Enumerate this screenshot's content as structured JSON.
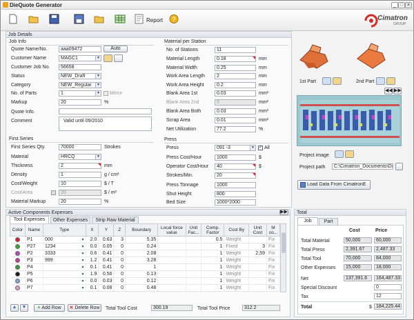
{
  "app": {
    "title": "DieQuote Generator",
    "report_label": "Report",
    "brand": "Cimatron",
    "brand_sub": "GROUP"
  },
  "job_details": {
    "section_title": "Job Details",
    "job_info_title": "Job Info",
    "quote_name_label": "Quote Name/No.",
    "quote_name": "aaa09472",
    "auto_label": "Auto",
    "customer_name_label": "Customer Name",
    "customer_name": "MAGC1",
    "customer_job_label": "Customer Job No.",
    "customer_job": "56658",
    "status_label": "Status",
    "status": "NEW_Draft",
    "category_label": "Category",
    "category": "NEW_Regular",
    "parts_label": "No. of Parts",
    "parts": "1",
    "mirror_label": "Mirror",
    "markup_label": "Markup",
    "markup": "20",
    "markup_unit": "%",
    "quote_info_label": "Quote Info.",
    "quote_info": "",
    "comment_label": "Comment",
    "comment": "Valid until 09/2010"
  },
  "first_series": {
    "title": "First Series",
    "qty_label": "First Series Qty.",
    "qty": "70000",
    "qty_unit": "Strokes",
    "material_label": "Material",
    "material": "HRCQ",
    "thickness_label": "Thickness",
    "thickness": "2",
    "thickness_unit": "mm",
    "density_label": "Density",
    "density": "1",
    "density_unit": "g / cm³",
    "cost_weight_label": "Cost/Weight",
    "cost_weight": "10",
    "cost_weight_unit": "$ / T",
    "cost_area_label": "Cost/Area",
    "cost_area": "20",
    "cost_area_unit": "$ / m²",
    "mat_markup_label": "Material Markup",
    "mat_markup": "20",
    "mat_markup_unit": "%"
  },
  "material_per_station": {
    "title": "Material per Station",
    "stations_label": "No. of Stations",
    "stations": "11",
    "length_label": "Material Length",
    "length": "0.18",
    "length_unit": "mm",
    "width_label": "Material Width",
    "width": "0.25",
    "width_unit": "mm",
    "wal_label": "Work Area Length",
    "wal": "2",
    "wal_unit": "mm",
    "wah_label": "Work Area Height",
    "wah": "0.2",
    "wah_unit": "mm",
    "ba1_label": "Blank Area 1st",
    "ba1": "0.03",
    "ba1_unit": "mm²",
    "ba2_label": "Blank Area 2nd",
    "ba2": "0",
    "ba2_unit": "mm²",
    "bab_label": "Blank Area Both",
    "bab": "0.03",
    "bab_unit": "mm²",
    "scrap_label": "Scrap Area",
    "scrap": "0.01",
    "scrap_unit": "mm²",
    "util_label": "Net Utilization",
    "util": "77.2",
    "util_unit": "%"
  },
  "press": {
    "title": "Press",
    "press_label": "Press",
    "press": "091 -3",
    "all_label": "All",
    "pch_label": "Press Cost/Hour",
    "pch": "1000",
    "pch_unit": "$",
    "och_label": "Operator Cost/Hour",
    "och": "40",
    "och_unit": "$",
    "spm_label": "Strokes/Min.",
    "spm": "20",
    "tonnage_label": "Press Tonnage",
    "tonnage": "1000",
    "shut_label": "Shut Height",
    "shut": "800",
    "bed_label": "Bed Size",
    "bed": "1000*2000"
  },
  "parts": {
    "first_label": "1st Part",
    "second_label": "2nd Part"
  },
  "project": {
    "image_label": "Project image",
    "path_label": "Project path",
    "path": "C:\\Cimatron_Documents\\Dx",
    "load_label": "Load Data From CimatronE"
  },
  "components": {
    "title": "Active Components Expenses",
    "tabs": [
      "Tool Expenses",
      "Other Expenses",
      "Strip Raw Material"
    ],
    "columns": [
      "Color",
      "Name",
      "Type",
      "X",
      "Y",
      "Z",
      "Boundary",
      "Local force value",
      "Unit Fac...",
      "Comp. Factor",
      "Cost By",
      "Unit Cost",
      "M co..."
    ],
    "rows": [
      {
        "color": "#d81f2a",
        "name": "P1",
        "type": "000",
        "x": "2.0",
        "y": "0.63",
        "z": "3",
        "boundary": "5.35",
        "force": "",
        "unit_fac": "",
        "comp": "0.5",
        "cost_by": "Weight",
        "unit_cost": "",
        "m": "Fix"
      },
      {
        "color": "#3da83c",
        "name": "P27",
        "type": "1234",
        "x": "0.0",
        "y": "0.05",
        "z": "0",
        "boundary": "0.24",
        "force": "",
        "unit_fac": "",
        "comp": "1",
        "cost_by": "Fixed",
        "unit_cost": "3",
        "m": "Fix"
      },
      {
        "color": "#b44ac2",
        "name": "P2",
        "type": "3333",
        "x": "0.6",
        "y": "0.41",
        "z": "0",
        "boundary": "2.08",
        "force": "",
        "unit_fac": "",
        "comp": "1",
        "cost_by": "Weight",
        "unit_cost": "2,59",
        "m": "Fix"
      },
      {
        "color": "#c63aa8",
        "name": "P3",
        "type": "999",
        "x": "1.2",
        "y": "0.41",
        "z": "0",
        "boundary": "3.28",
        "force": "",
        "unit_fac": "",
        "comp": "1",
        "cost_by": "Weight",
        "unit_cost": "",
        "m": "Fix"
      },
      {
        "color": "#3f9a3e",
        "name": "P4",
        "type": "",
        "x": "0.1",
        "y": "0.41",
        "z": "0",
        "boundary": "1",
        "force": "",
        "unit_fac": "",
        "comp": "1",
        "cost_by": "Weight",
        "unit_cost": "",
        "m": "Fix"
      },
      {
        "color": "#1a1a1a",
        "name": "P5",
        "type": "",
        "x": "1.9",
        "y": "0.56",
        "z": "0",
        "boundary": "0.13",
        "force": "",
        "unit_fac": "",
        "comp": "1",
        "cost_by": "Weight",
        "unit_cost": "",
        "m": "Fix"
      },
      {
        "color": "#8aa5d8",
        "name": "P6",
        "type": "",
        "x": "0.0",
        "y": "0.03",
        "z": "0",
        "boundary": "0.12",
        "force": "",
        "unit_fac": "",
        "comp": "1",
        "cost_by": "Weight",
        "unit_cost": "",
        "m": "Fix"
      },
      {
        "color": "#d89bc8",
        "name": "P7",
        "type": "",
        "x": "0.1",
        "y": "0.08",
        "z": "0",
        "boundary": "0.48",
        "force": "",
        "unit_fac": "",
        "comp": "1",
        "cost_by": "Weight",
        "unit_cost": "",
        "m": "Fix"
      }
    ],
    "add_row": "Add Row",
    "delete_row": "Delete Row",
    "total_cost_label": "Total Tool Cost",
    "total_cost": "300.19",
    "total_price_label": "Total Tool Price",
    "total_price": "312.2"
  },
  "total": {
    "title": "Total",
    "tabs": [
      "Job",
      "Part"
    ],
    "cost_header": "Cost",
    "price_header": "Price",
    "rows": [
      {
        "label": "Total Material",
        "cost": "50,000",
        "price": "60,000"
      },
      {
        "label": "Total Press",
        "cost": "2,391.67",
        "price": "2,487.33"
      },
      {
        "label": "Total Tool",
        "cost": "70,000",
        "price": "84,000"
      },
      {
        "label": "Other Expenses",
        "cost": "15,000",
        "price": "18,000"
      }
    ],
    "net_label": "Net",
    "net_cost": "137,391.6",
    "net_price": "164,487.33",
    "discount_label": "Special Discount",
    "discount": "0",
    "tax_label": "Tax",
    "tax": "12",
    "total_label": "Total",
    "currency": "$",
    "total_value": "184,225.44"
  }
}
